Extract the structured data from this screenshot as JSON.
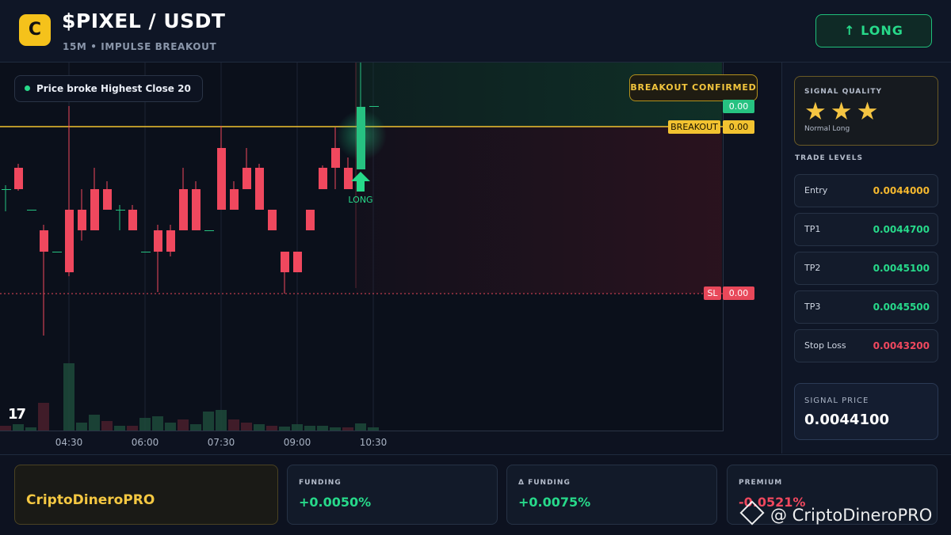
{
  "header": {
    "logo_letter": "C",
    "pair": "$PIXEL / USDT",
    "subtitle": "15M • IMPULSE BREAKOUT",
    "direction_button": "↑ LONG"
  },
  "chart": {
    "message": "Price broke Highest Close 20",
    "status_badge": "BREAKOUT CONFIRMED",
    "current_price_tag": "0.00",
    "breakout_label": "BREAKOUT",
    "breakout_value": "0.00",
    "sl_label": "SL",
    "sl_value": "0.00",
    "signal_marker": "LONG",
    "tv_logo": "17",
    "x_ticks": [
      "04:30",
      "06:00",
      "07:30",
      "09:00",
      "10:30"
    ],
    "colors": {
      "up": "#26c281",
      "down": "#f0485e",
      "breakout": "#f2c230",
      "sl": "#e8485a"
    }
  },
  "sidebar": {
    "quality_title": "SIGNAL QUALITY",
    "quality_stars": "★★★",
    "quality_rating": 3,
    "quality_label": "Normal Long",
    "levels_title": "TRADE LEVELS",
    "levels": [
      {
        "name": "Entry",
        "value": "0.0044000",
        "color": "#f5b82e"
      },
      {
        "name": "TP1",
        "value": "0.0044700",
        "color": "#27d98a"
      },
      {
        "name": "TP2",
        "value": "0.0045100",
        "color": "#27d98a"
      },
      {
        "name": "TP3",
        "value": "0.0045500",
        "color": "#27d98a"
      },
      {
        "name": "Stop Loss",
        "value": "0.0043200",
        "color": "#f0485e"
      }
    ],
    "signal_price_title": "SIGNAL PRICE",
    "signal_price": "0.0044100"
  },
  "footer": {
    "brand": "CriptoDineroPRO",
    "cards": [
      {
        "title": "FUNDING",
        "value": "+0.0050%",
        "color": "#27d98a"
      },
      {
        "title": "Δ FUNDING",
        "value": "+0.0075%",
        "color": "#27d98a"
      },
      {
        "title": "PREMIUM",
        "value": "-0.0521%",
        "color": "#f0485e"
      }
    ],
    "watermark": "@ CriptoDineroPRO"
  }
}
